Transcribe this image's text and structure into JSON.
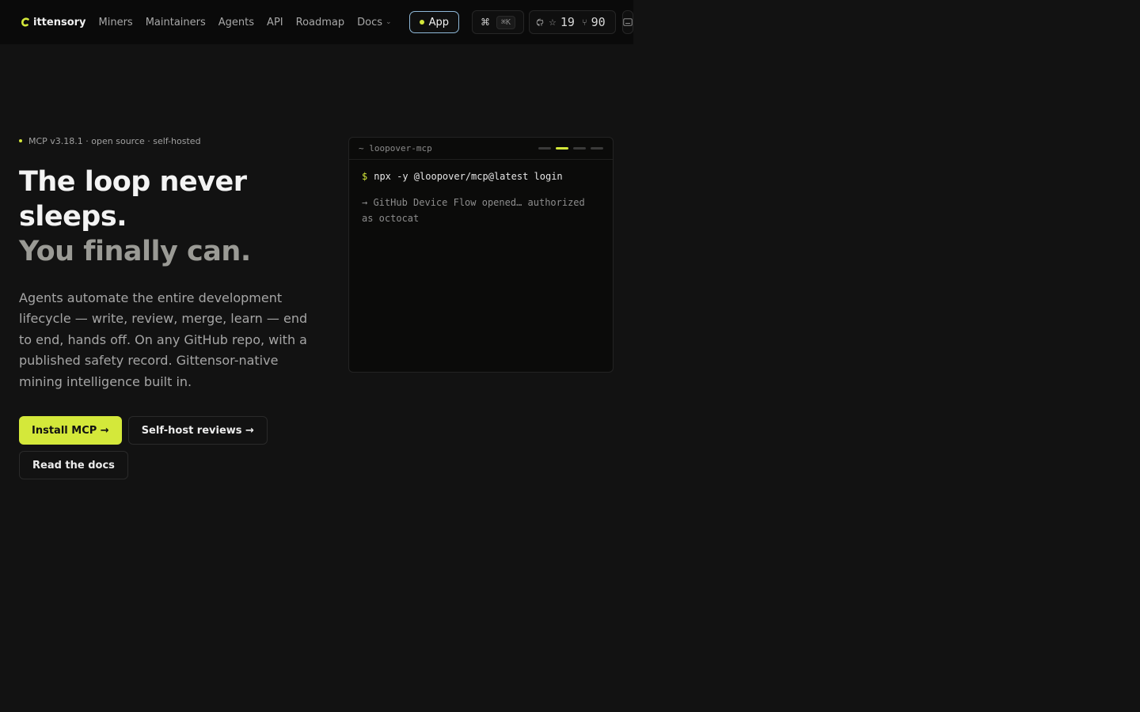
{
  "header": {
    "brand": "ittensory",
    "nav": [
      "Miners",
      "Maintainers",
      "Agents",
      "API",
      "Roadmap"
    ],
    "docs_label": "Docs",
    "app_label": "App",
    "cmd_symbol": "⌘",
    "cmd_shortcut": "⌘K",
    "stars": "19",
    "forks": "90"
  },
  "hero": {
    "badge": "MCP v3.18.1 · open source · self-hosted",
    "headline_line1": "The loop never sleeps.",
    "headline_line2": "You finally can.",
    "lede": "Agents automate the entire development lifecycle — write, review, merge, learn — end to end, hands off. On any GitHub repo, with a published safety record. Gittensor-native mining intelligence built in.",
    "cta_primary": "Install MCP →",
    "cta_secondary": "Self-host reviews →",
    "cta_docs": "Read the docs"
  },
  "terminal": {
    "title": "~ loopover-mcp",
    "prompt": "$",
    "command": "npx -y @loopover/mcp@latest login",
    "output": "→ GitHub Device Flow opened… authorized as octocat",
    "active_step": 2,
    "step_count": 4
  },
  "colors": {
    "accent": "#d4e83a",
    "background": "#121212",
    "header_bg": "#0a0a0a"
  }
}
